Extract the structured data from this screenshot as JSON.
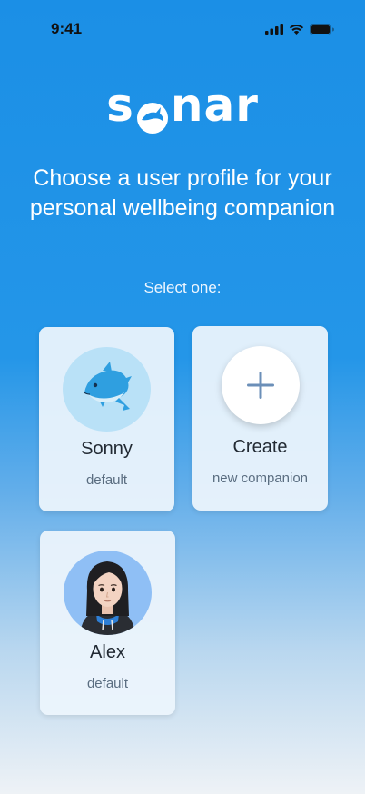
{
  "status_bar": {
    "time": "9:41"
  },
  "app": {
    "logo_text_start": "s",
    "logo_text_end": "nar"
  },
  "headline": "Choose a user profile for your personal wellbeing companion",
  "subhead": "Select one:",
  "profiles": [
    {
      "name": "Sonny",
      "subtitle": "default",
      "avatar": "dolphin"
    },
    {
      "name": "Create",
      "subtitle": "new companion",
      "avatar": "plus-icon"
    },
    {
      "name": "Alex",
      "subtitle": "default",
      "avatar": "person"
    }
  ],
  "colors": {
    "accent": "#1b8fe6",
    "card": "#ecf4fc",
    "plus": "#6b8fb8"
  }
}
